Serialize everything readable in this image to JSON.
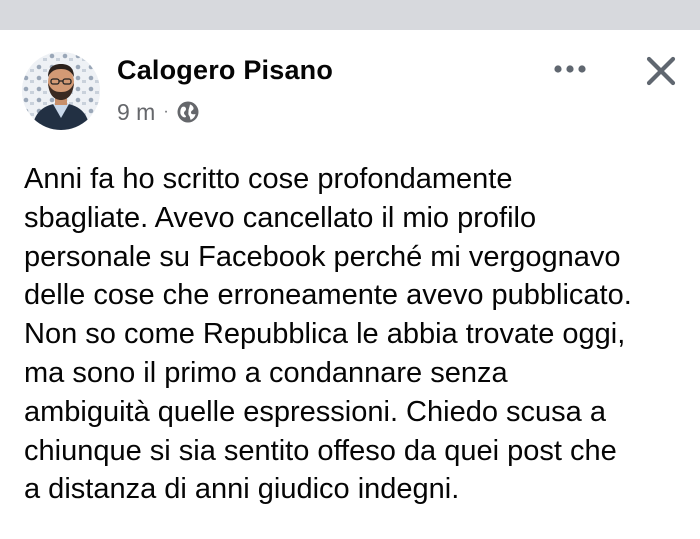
{
  "post": {
    "author_name": "Calogero Pisano",
    "timestamp": "9 m",
    "separator": "·",
    "privacy_icon": "globe-icon",
    "more_icon": "more-options-icon",
    "close_icon": "close-icon",
    "avatar_icon": "profile-photo",
    "text_lines": [
      "Anni fa ho scritto cose profondamente",
      "sbagliate. Avevo cancellato il mio profilo",
      "personale su Facebook perché mi vergognavo",
      "delle cose che erroneamente avevo pubblicato.",
      "Non so come Repubblica le abbia trovate oggi,",
      "ma sono il primo a condannare senza",
      "ambiguità quelle espressioni. Chiedo scusa a",
      "chiunque si sia sentito offeso da quei post che",
      "a distanza di anni giudico indegni."
    ]
  },
  "colors": {
    "top_strip": "#d7d9dd",
    "text_primary": "#050505",
    "text_secondary": "#65676b",
    "icon": "#606770"
  }
}
